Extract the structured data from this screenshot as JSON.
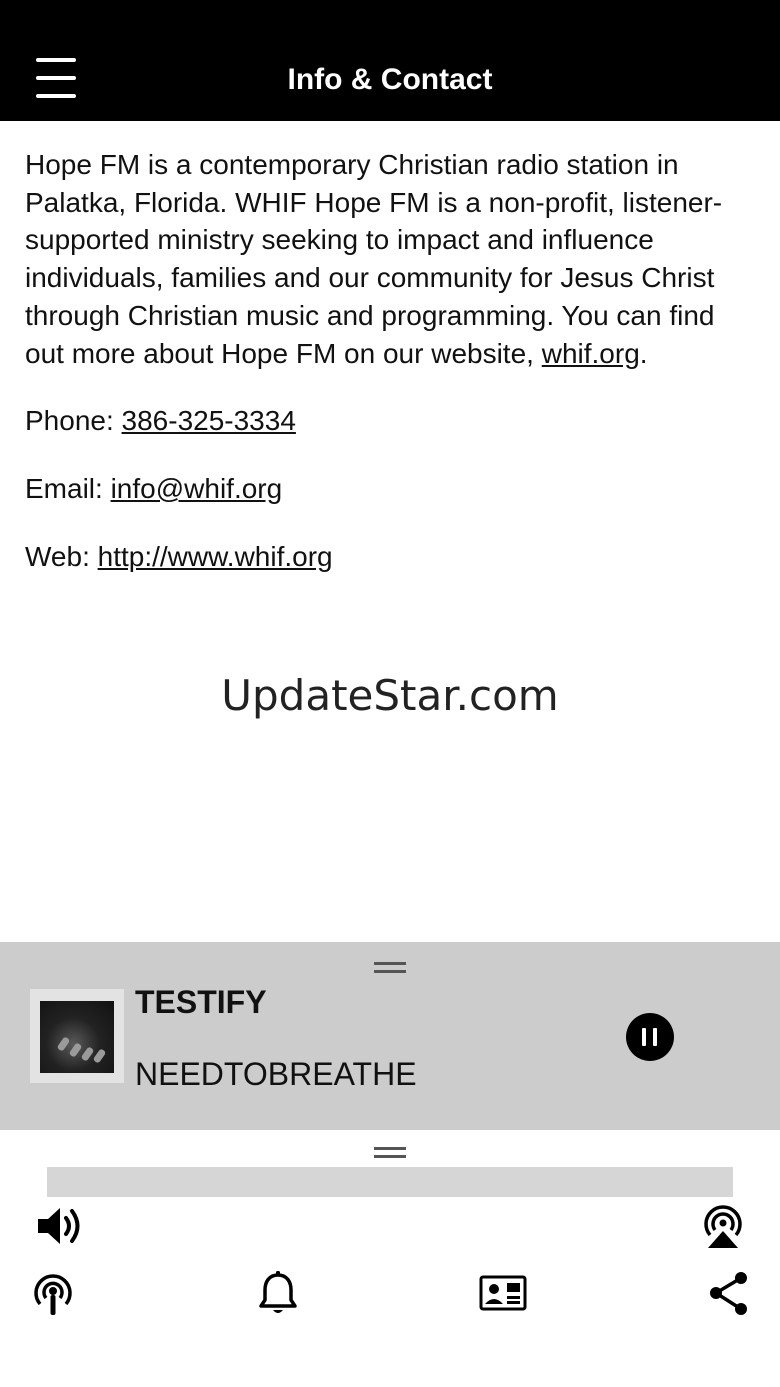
{
  "header": {
    "title": "Info & Contact",
    "menu_icon": "hamburger-menu-icon"
  },
  "content": {
    "description": "Hope FM is a contemporary Christian radio station in Palatka, Florida. WHIF Hope FM is a non-profit, listener-supported ministry seeking to impact and influence individuals, families and our community for Jesus Christ through Christian music and programming. You can find out more about Hope FM on our website, ",
    "description_link": "whif.org",
    "description_end": ".",
    "phone_label": "Phone: ",
    "phone_value": "386-325-3334",
    "email_label": "Email: ",
    "email_value": "info@whif.org",
    "web_label": "Web: ",
    "web_value": "http://www.whif.org",
    "brand": "UpdateStar.com"
  },
  "player": {
    "track_title": "TESTIFY",
    "track_artist": "NEEDTOBREATHE",
    "state_icon": "pause-icon",
    "progress": 0.0
  },
  "toolbar": {
    "row1": [
      "volume-icon",
      "airplay-icon"
    ],
    "row2": [
      "podcast-icon",
      "bell-icon",
      "contact-card-icon",
      "share-icon"
    ]
  },
  "colors": {
    "header_bg": "#000000",
    "player_bg": "#cccccc",
    "progress_track": "#d6d6d6",
    "text": "#111111"
  }
}
